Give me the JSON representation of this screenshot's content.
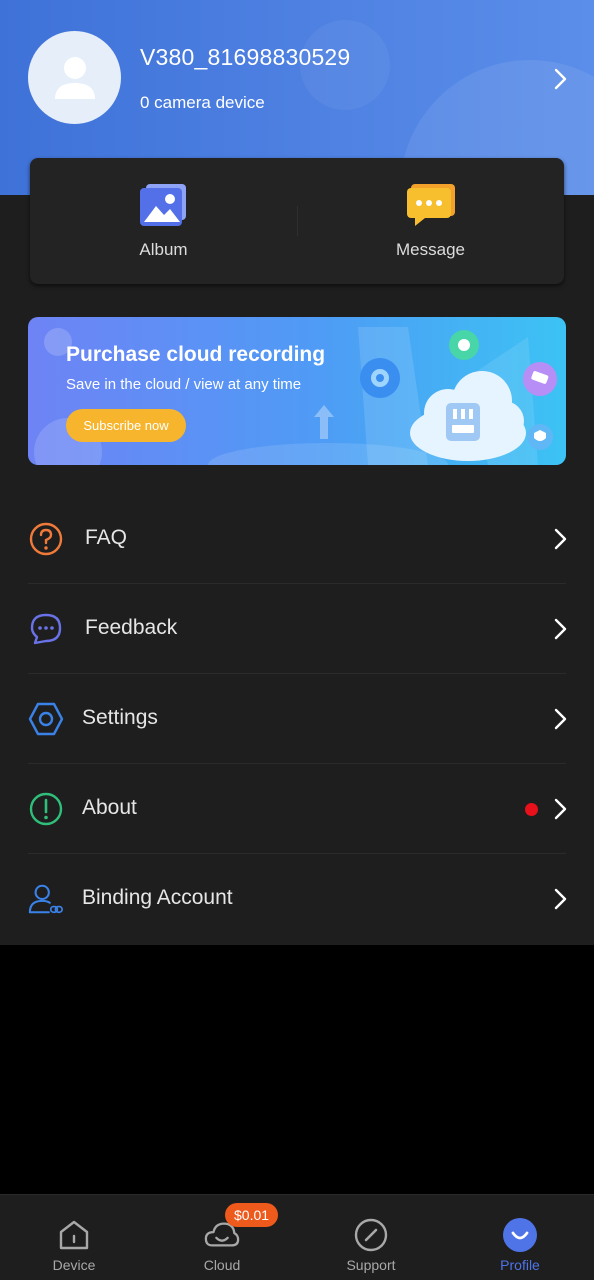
{
  "profile": {
    "username": "V380_81698830529",
    "device_count": "0 camera device"
  },
  "quick_actions": [
    {
      "label": "Album",
      "icon": "album-icon"
    },
    {
      "label": "Message",
      "icon": "message-icon"
    }
  ],
  "banner": {
    "title": "Purchase cloud recording",
    "subtitle": "Save in the cloud / view at any time",
    "button": "Subscribe now"
  },
  "menu": {
    "faq": "FAQ",
    "feedback": "Feedback",
    "settings": "Settings",
    "about": "About",
    "binding": "Binding Account"
  },
  "tabs": {
    "device": "Device",
    "cloud": "Cloud",
    "cloud_badge": "$0.01",
    "support": "Support",
    "profile": "Profile",
    "active": "Profile"
  },
  "colors": {
    "header_gradient_start": "#3f72d8",
    "header_gradient_end": "#5b8eea",
    "accent": "#4f74e8",
    "faq_icon": "#f07a3a",
    "feedback_icon": "#6a72e8",
    "settings_icon": "#3a82e8",
    "about_icon": "#2fbf7a",
    "notification_dot": "#e8101a",
    "badge": "#ee5a1c",
    "subscribe_button": "#f6b52c"
  }
}
